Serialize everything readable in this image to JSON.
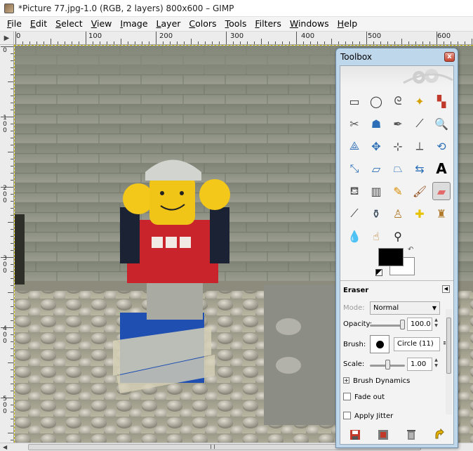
{
  "window": {
    "title": "*Picture 77.jpg-1.0 (RGB, 2 layers) 800x600 – GIMP",
    "icon": "gimp-image-icon"
  },
  "menubar": {
    "items": [
      "File",
      "Edit",
      "Select",
      "View",
      "Image",
      "Layer",
      "Colors",
      "Tools",
      "Filters",
      "Windows",
      "Help"
    ]
  },
  "rulers": {
    "corner_glyph": "▶",
    "h_labels": [
      "0",
      "100",
      "200",
      "300",
      "400",
      "500",
      "600"
    ],
    "v_labels": [
      "0",
      "100",
      "200",
      "300",
      "400",
      "500"
    ]
  },
  "toolbox": {
    "title": "Toolbox",
    "close_glyph": "x",
    "tools": [
      "rect-select-icon",
      "ellipse-select-icon",
      "free-select-icon",
      "fuzzy-select-icon",
      "color-select-icon",
      "scissors-icon",
      "foreground-select-icon",
      "paths-icon",
      "color-picker-icon",
      "zoom-icon",
      "measure-icon",
      "move-icon",
      "align-icon",
      "crop-icon",
      "rotate-icon",
      "scale-icon",
      "shear-icon",
      "perspective-icon",
      "flip-icon",
      "text-icon",
      "bucket-fill-icon",
      "blend-icon",
      "pencil-icon",
      "paintbrush-icon",
      "eraser-icon",
      "airbrush-icon",
      "ink-icon",
      "clone-icon",
      "heal-icon",
      "perspective-clone-icon",
      "blur-icon",
      "smudge-icon",
      "dodge-burn-icon"
    ],
    "active_tool": "eraser-icon",
    "colors": {
      "foreground": "#000000",
      "background": "#ffffff",
      "swap_glyph": "↶"
    },
    "options": {
      "section": "Eraser",
      "mode_label": "Mode:",
      "mode_value": "Normal",
      "opacity_label": "Opacity:",
      "opacity_value": "100.0",
      "opacity_level": 1.0,
      "brush_label": "Brush:",
      "brush_name": "Circle (11)",
      "scale_label": "Scale:",
      "scale_value": "1.00",
      "scale_level": 0.5,
      "brush_dynamics": "Brush Dynamics",
      "expander_glyph": "+",
      "fade_out": "Fade out",
      "apply_jitter": "Apply Jitter"
    }
  }
}
